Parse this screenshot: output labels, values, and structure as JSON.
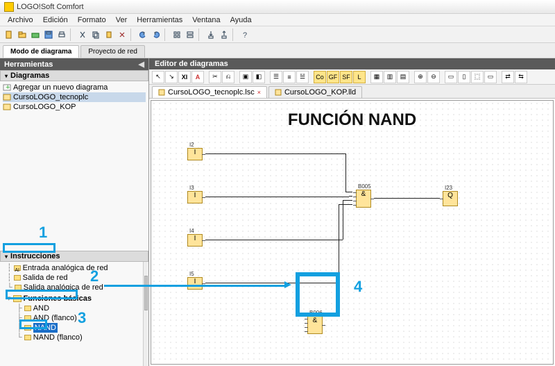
{
  "window": {
    "title": "LOGO!Soft Comfort"
  },
  "menu": {
    "items": [
      "Archivo",
      "Edición",
      "Formato",
      "Ver",
      "Herramientas",
      "Ventana",
      "Ayuda"
    ]
  },
  "modetabs": {
    "active": "Modo de diagrama",
    "inactive": "Proyecto de red"
  },
  "left": {
    "tools_title": "Herramientas",
    "diagrams_title": "Diagramas",
    "diag_items": {
      "add": "Agregar un nuevo diagrama",
      "d1": "CursoLOGO_tecnoplc",
      "d2": "CursoLOGO_KOP"
    },
    "instr_title": "Instrucciones",
    "instr_plain": {
      "a": "Entrada analógica de red",
      "b": "Salida de red",
      "c": "Salida analógica de red"
    },
    "basicfn_title": "Funciones básicas",
    "basicfn_items": {
      "and": "AND",
      "andf": "AND (flanco)",
      "nand": "NAND",
      "nandf": "NAND (flanco)"
    }
  },
  "editor": {
    "title": "Editor de diagramas",
    "tabs": {
      "t1": "CursoLOGO_tecnoplc.lsc",
      "t2": "CursoLOGO_KOP.lld"
    },
    "close_x": "×"
  },
  "canvas": {
    "title": "FUNCIÓN NAND",
    "blocks": {
      "i2": "I2",
      "i3": "I3",
      "i4": "I4",
      "i5": "I5",
      "b005": "B005",
      "b006": "B006",
      "q": "Q",
      "i23": "I23"
    },
    "sym": {
      "I": "I",
      "AND": "&",
      "Q": "Q"
    }
  },
  "annot": {
    "n1": "1",
    "n2": "2",
    "n3": "3",
    "n4": "4"
  }
}
